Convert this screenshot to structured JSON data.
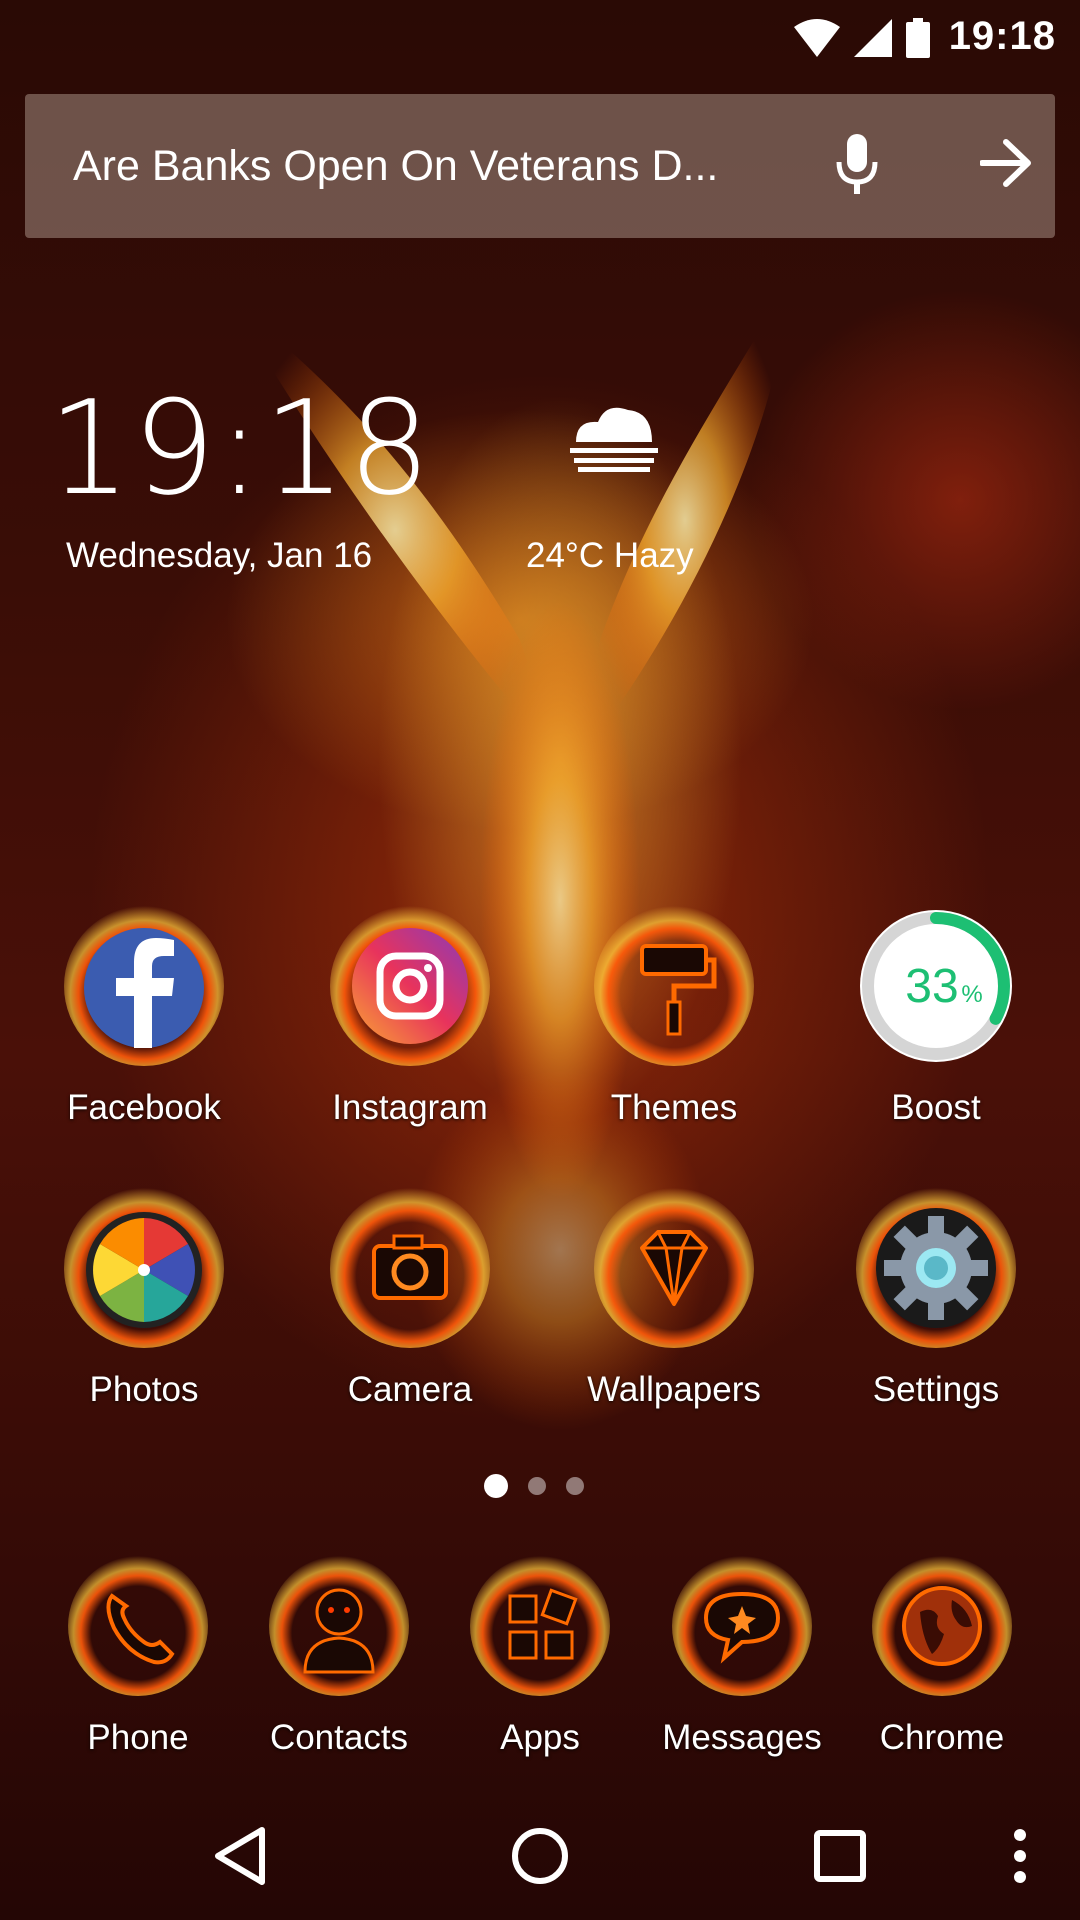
{
  "status_bar": {
    "time": "19:18"
  },
  "search": {
    "query": "Are Banks Open On Veterans D..."
  },
  "clock_widget": {
    "time": "19:18",
    "date": "Wednesday, Jan 16",
    "weather": "24°C Hazy",
    "weather_icon": "fog-cloud-icon"
  },
  "home_apps": [
    {
      "label": "Facebook",
      "icon": "facebook-icon"
    },
    {
      "label": "Instagram",
      "icon": "instagram-icon"
    },
    {
      "label": "Themes",
      "icon": "paint-roller-icon"
    },
    {
      "label": "Boost",
      "icon": "boost-gauge-icon",
      "percent_value": "33",
      "percent_sign": "%",
      "progress": 0.33
    },
    {
      "label": "Photos",
      "icon": "photos-pinwheel-icon"
    },
    {
      "label": "Camera",
      "icon": "camera-icon"
    },
    {
      "label": "Wallpapers",
      "icon": "diamond-icon"
    },
    {
      "label": "Settings",
      "icon": "gear-icon"
    }
  ],
  "page_indicator": {
    "pages": 3,
    "current": 1
  },
  "dock": [
    {
      "label": "Phone",
      "icon": "phone-icon"
    },
    {
      "label": "Contacts",
      "icon": "contacts-icon"
    },
    {
      "label": "Apps",
      "icon": "apps-grid-icon"
    },
    {
      "label": "Messages",
      "icon": "messages-icon"
    },
    {
      "label": "Chrome",
      "icon": "globe-icon"
    }
  ],
  "nav_bar": {
    "buttons": [
      "back-icon",
      "home-icon",
      "recents-icon",
      "more-icon"
    ]
  },
  "colors": {
    "boost_green": "#1dbf73",
    "flame": "#ff7a1a"
  }
}
